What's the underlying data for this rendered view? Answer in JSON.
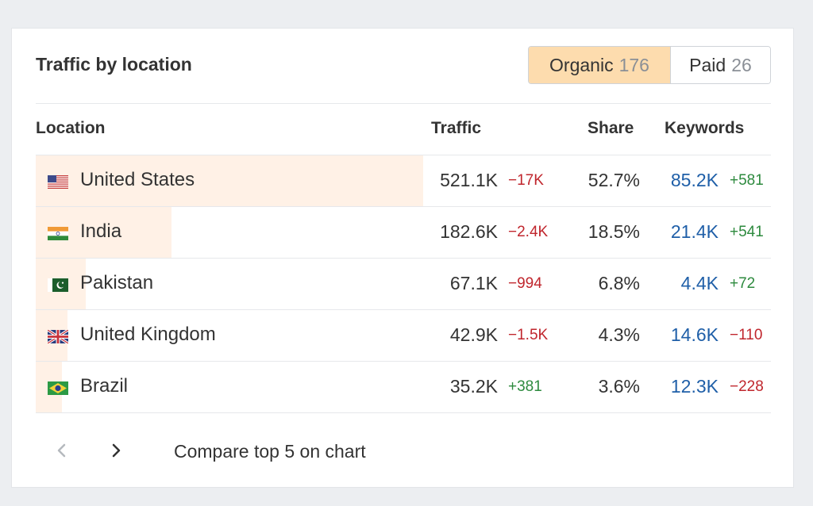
{
  "widget": {
    "title": "Traffic by location",
    "tabs": [
      {
        "label": "Organic",
        "count": "176",
        "active": true
      },
      {
        "label": "Paid",
        "count": "26",
        "active": false
      }
    ],
    "columns": {
      "location": "Location",
      "traffic": "Traffic",
      "share": "Share",
      "keywords": "Keywords"
    },
    "rows": [
      {
        "country": "United States",
        "flag": "us-flag-icon",
        "traffic": "521.1K",
        "traffic_change": "−17K",
        "traffic_change_dir": "down",
        "share": "52.7%",
        "share_value": 52.7,
        "keywords": "85.2K",
        "keywords_change": "+581",
        "keywords_change_dir": "up"
      },
      {
        "country": "India",
        "flag": "india-flag-icon",
        "traffic": "182.6K",
        "traffic_change": "−2.4K",
        "traffic_change_dir": "down",
        "share": "18.5%",
        "share_value": 18.5,
        "keywords": "21.4K",
        "keywords_change": "+541",
        "keywords_change_dir": "up"
      },
      {
        "country": "Pakistan",
        "flag": "pakistan-flag-icon",
        "traffic": "67.1K",
        "traffic_change": "−994",
        "traffic_change_dir": "down",
        "share": "6.8%",
        "share_value": 6.8,
        "keywords": "4.4K",
        "keywords_change": "+72",
        "keywords_change_dir": "up"
      },
      {
        "country": "United Kingdom",
        "flag": "uk-flag-icon",
        "traffic": "42.9K",
        "traffic_change": "−1.5K",
        "traffic_change_dir": "down",
        "share": "4.3%",
        "share_value": 4.3,
        "keywords": "14.6K",
        "keywords_change": "−110",
        "keywords_change_dir": "down"
      },
      {
        "country": "Brazil",
        "flag": "brazil-flag-icon",
        "traffic": "35.2K",
        "traffic_change": "+381",
        "traffic_change_dir": "up",
        "share": "3.6%",
        "share_value": 3.6,
        "keywords": "12.3K",
        "keywords_change": "−228",
        "keywords_change_dir": "down"
      }
    ],
    "footer": {
      "prev_icon": "chevron-left-icon",
      "next_icon": "chevron-right-icon",
      "compare_label": "Compare top 5 on chart"
    },
    "colors": {
      "share_bar": "#fff1e6",
      "active_tab": "#fddcae",
      "negative": "#c0262d",
      "positive": "#2d8a3e",
      "link": "#1f5fa8"
    }
  }
}
